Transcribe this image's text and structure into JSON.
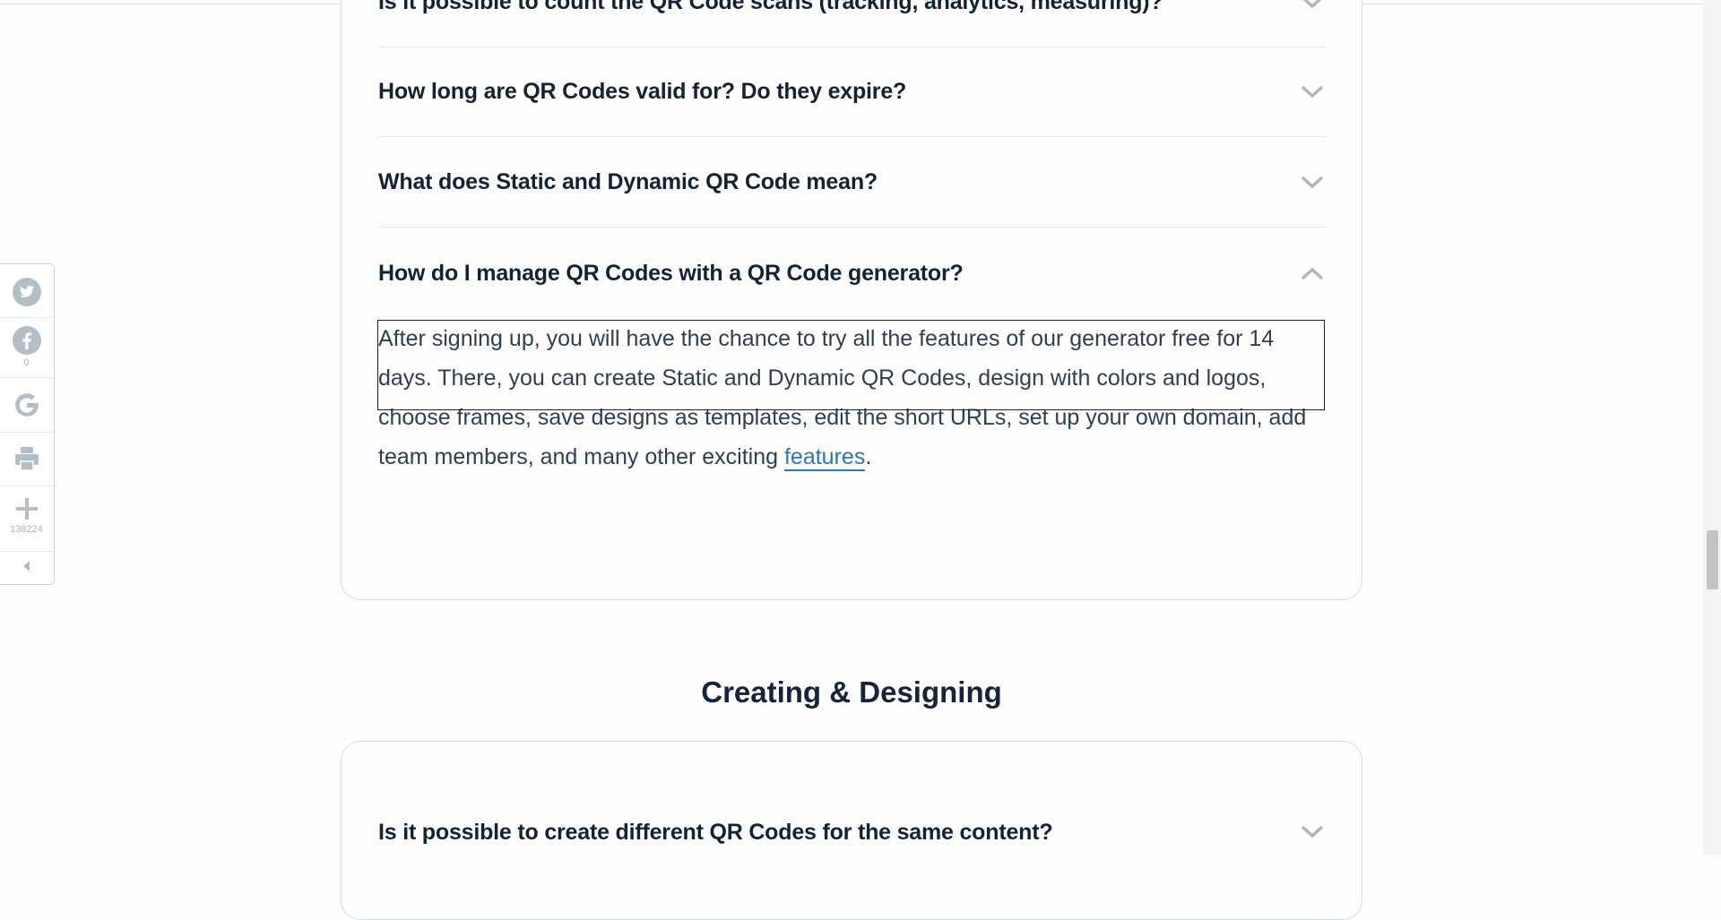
{
  "faq_top": {
    "items": [
      {
        "question": "Is it possible to count the QR Code scans (tracking, analytics, measuring)?",
        "expanded": false
      },
      {
        "question": "How long are QR Codes valid for? Do they expire?",
        "expanded": false
      },
      {
        "question": "What does Static and Dynamic QR Code mean?",
        "expanded": false
      },
      {
        "question": "How do I manage QR Codes with a QR Code generator?",
        "expanded": true
      }
    ],
    "answer": {
      "text": "After signing up, you will have the chance to try all the features of our generator free for 14 days. There, you can create Static and Dynamic QR Codes, design with colors and logos, choose frames, save designs as templates, edit the short URLs, set up your own domain, add team members, and many other exciting ",
      "link_label": "features",
      "trailing": "."
    }
  },
  "section": {
    "title": "Creating & Designing"
  },
  "faq_bottom": {
    "items": [
      {
        "question": "Is it possible to create different QR Codes for the same content?",
        "expanded": false
      }
    ]
  },
  "share_bar": {
    "facebook_count": "0",
    "more_count": "138224",
    "icons": [
      "twitter-icon",
      "facebook-icon",
      "google-icon",
      "print-icon",
      "plus-icon",
      "collapse-icon"
    ]
  },
  "colors": {
    "heading": "#142234",
    "body_text": "#2e3f54",
    "link": "#2b78b8",
    "chevron": "#aab8c4",
    "icon_gray": "#b4bec6"
  }
}
